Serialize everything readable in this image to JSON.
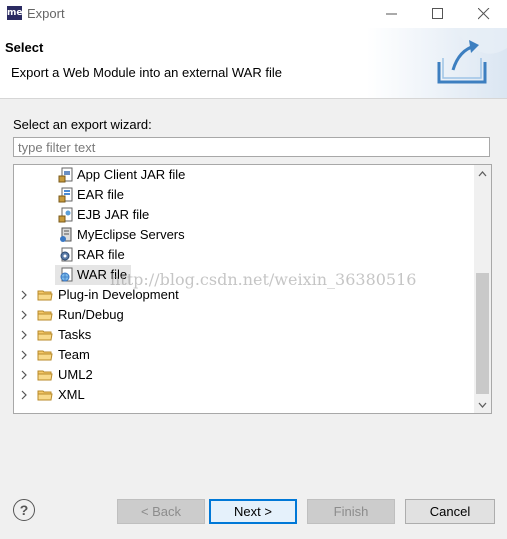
{
  "window": {
    "icon_text": "me",
    "title": "Export"
  },
  "header": {
    "title": "Select",
    "description": "Export a Web Module into an external WAR file"
  },
  "wizard": {
    "prompt": "Select an export wizard:",
    "filter_placeholder": "type filter text"
  },
  "tree": {
    "children": [
      {
        "label": "App Client JAR file",
        "icon": "app-client-jar-icon"
      },
      {
        "label": "EAR file",
        "icon": "ear-file-icon"
      },
      {
        "label": "EJB JAR file",
        "icon": "ejb-jar-icon"
      },
      {
        "label": "MyEclipse Servers",
        "icon": "servers-icon"
      },
      {
        "label": "RAR file",
        "icon": "rar-file-icon"
      },
      {
        "label": "WAR file",
        "icon": "war-file-icon",
        "selected": true
      }
    ],
    "folders": [
      {
        "label": "Plug-in Development"
      },
      {
        "label": "Run/Debug"
      },
      {
        "label": "Tasks"
      },
      {
        "label": "Team"
      },
      {
        "label": "UML2"
      },
      {
        "label": "XML"
      }
    ]
  },
  "watermark": "http://blog.csdn.net/weixin_36380516",
  "buttons": {
    "back": "< Back",
    "next": "Next >",
    "finish": "Finish",
    "cancel": "Cancel",
    "help": "?"
  }
}
